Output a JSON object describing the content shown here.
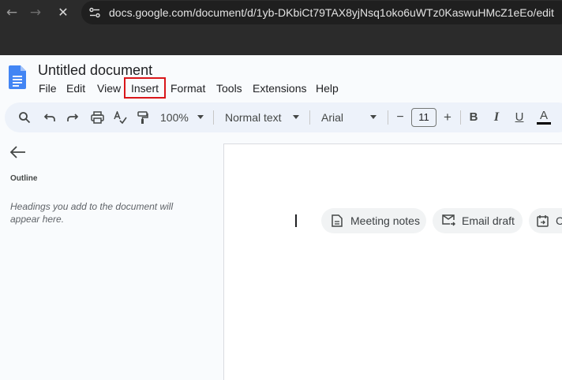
{
  "browser": {
    "url": "docs.google.com/document/d/1yb-DKbiCt79TAX8yjNsq1oko6uWTz0KaswuHMcZ1eEo/edit",
    "icons": [
      "back-arrow",
      "forward-arrow",
      "stop-loading",
      "site-info"
    ]
  },
  "docs": {
    "title": "Untitled document",
    "menu": [
      "File",
      "Edit",
      "View",
      "Insert",
      "Format",
      "Tools",
      "Extensions",
      "Help"
    ],
    "highlighted_menu": "Insert",
    "highlight_color": "#d9161a"
  },
  "toolbar": {
    "zoom": "100%",
    "style": "Normal text",
    "font": "Arial",
    "font_size": "11",
    "minus": "−",
    "plus": "+",
    "bold": "B",
    "italic": "I",
    "underline": "U",
    "text_color": "A",
    "icons": [
      "search",
      "undo",
      "redo",
      "print",
      "spellcheck",
      "paint-format",
      "decrease-font",
      "increase-font",
      "bold",
      "italic",
      "underline",
      "text-color"
    ]
  },
  "outline": {
    "title": "Outline",
    "hint": "Headings you add to the document will appear here."
  },
  "document": {
    "chips": [
      "Meeting notes",
      "Email draft",
      "C"
    ]
  },
  "colors": {
    "browser_bg": "#2b2b2b",
    "toolbar_bg": "#edf2fa",
    "page_bg": "#f9fbfd",
    "docs_blue": "#4285f4"
  }
}
